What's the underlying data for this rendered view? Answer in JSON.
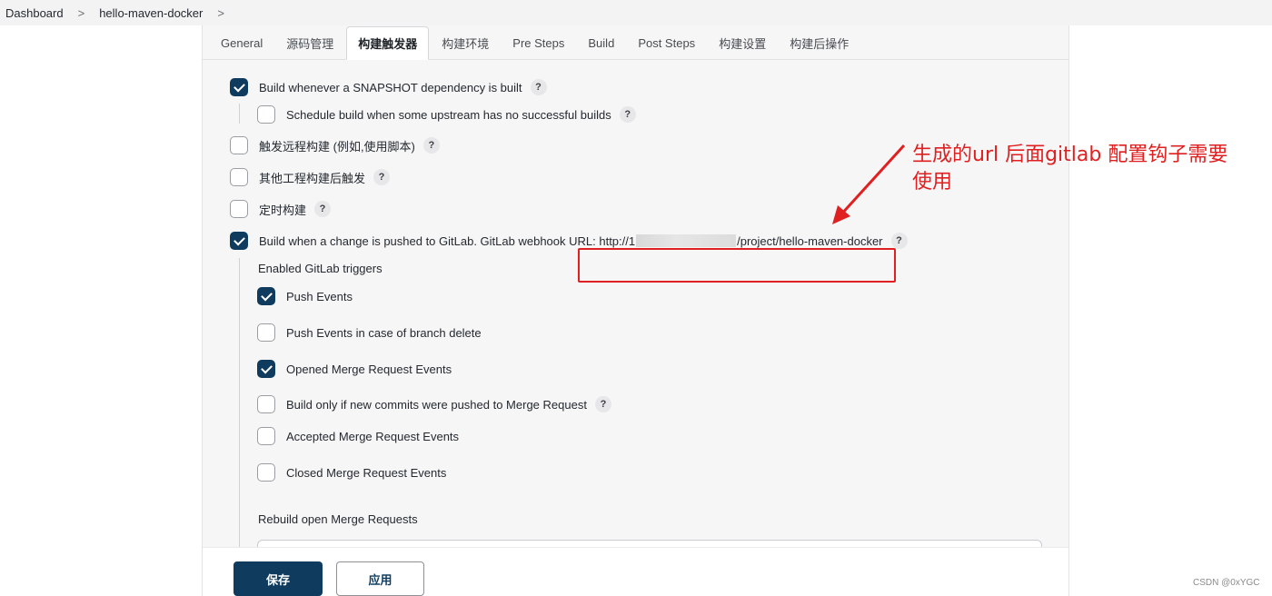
{
  "breadcrumb": {
    "items": [
      "Dashboard",
      "hello-maven-docker"
    ],
    "separator": ">"
  },
  "tabs": [
    {
      "label": "General",
      "active": false
    },
    {
      "label": "源码管理",
      "active": false
    },
    {
      "label": "构建触发器",
      "active": true
    },
    {
      "label": "构建环境",
      "active": false
    },
    {
      "label": "Pre Steps",
      "active": false
    },
    {
      "label": "Build",
      "active": false
    },
    {
      "label": "Post Steps",
      "active": false
    },
    {
      "label": "构建设置",
      "active": false
    },
    {
      "label": "构建后操作",
      "active": false
    }
  ],
  "triggers": {
    "snapshot": {
      "label": "Build whenever a SNAPSHOT dependency is built",
      "checked": true
    },
    "upstream": {
      "label": "Schedule build when some upstream has no successful builds",
      "checked": false
    },
    "remote": {
      "label": "触发远程构建 (例如,使用脚本)",
      "checked": false
    },
    "after_other": {
      "label": "其他工程构建后触发",
      "checked": false
    },
    "timed": {
      "label": "定时构建",
      "checked": false
    },
    "gitlab": {
      "label_prefix": "Build when a change is pushed to GitLab. GitLab webhook URL: http://1",
      "label_suffix": "/project/hello-maven-docker",
      "checked": true
    }
  },
  "gitlab_triggers": {
    "heading": "Enabled GitLab triggers",
    "items": [
      {
        "label": "Push Events",
        "checked": true,
        "help": false
      },
      {
        "label": "Push Events in case of branch delete",
        "checked": false,
        "help": false
      },
      {
        "label": "Opened Merge Request Events",
        "checked": true,
        "help": false
      },
      {
        "label": "Build only if new commits were pushed to Merge Request",
        "checked": false,
        "help": true
      },
      {
        "label": "Accepted Merge Request Events",
        "checked": false,
        "help": false
      },
      {
        "label": "Closed Merge Request Events",
        "checked": false,
        "help": false
      }
    ],
    "rebuild_label": "Rebuild open Merge Requests"
  },
  "buttons": {
    "save": "保存",
    "apply": "应用"
  },
  "help_glyph": "?",
  "annotation": {
    "line1": "生成的url  后面gitlab 配置钩子需要",
    "line2": "使用",
    "color": "#e02020"
  },
  "watermark": "CSDN @0xYGC",
  "colors": {
    "primary": "#0f3c5e",
    "highlight": "#e02020"
  }
}
